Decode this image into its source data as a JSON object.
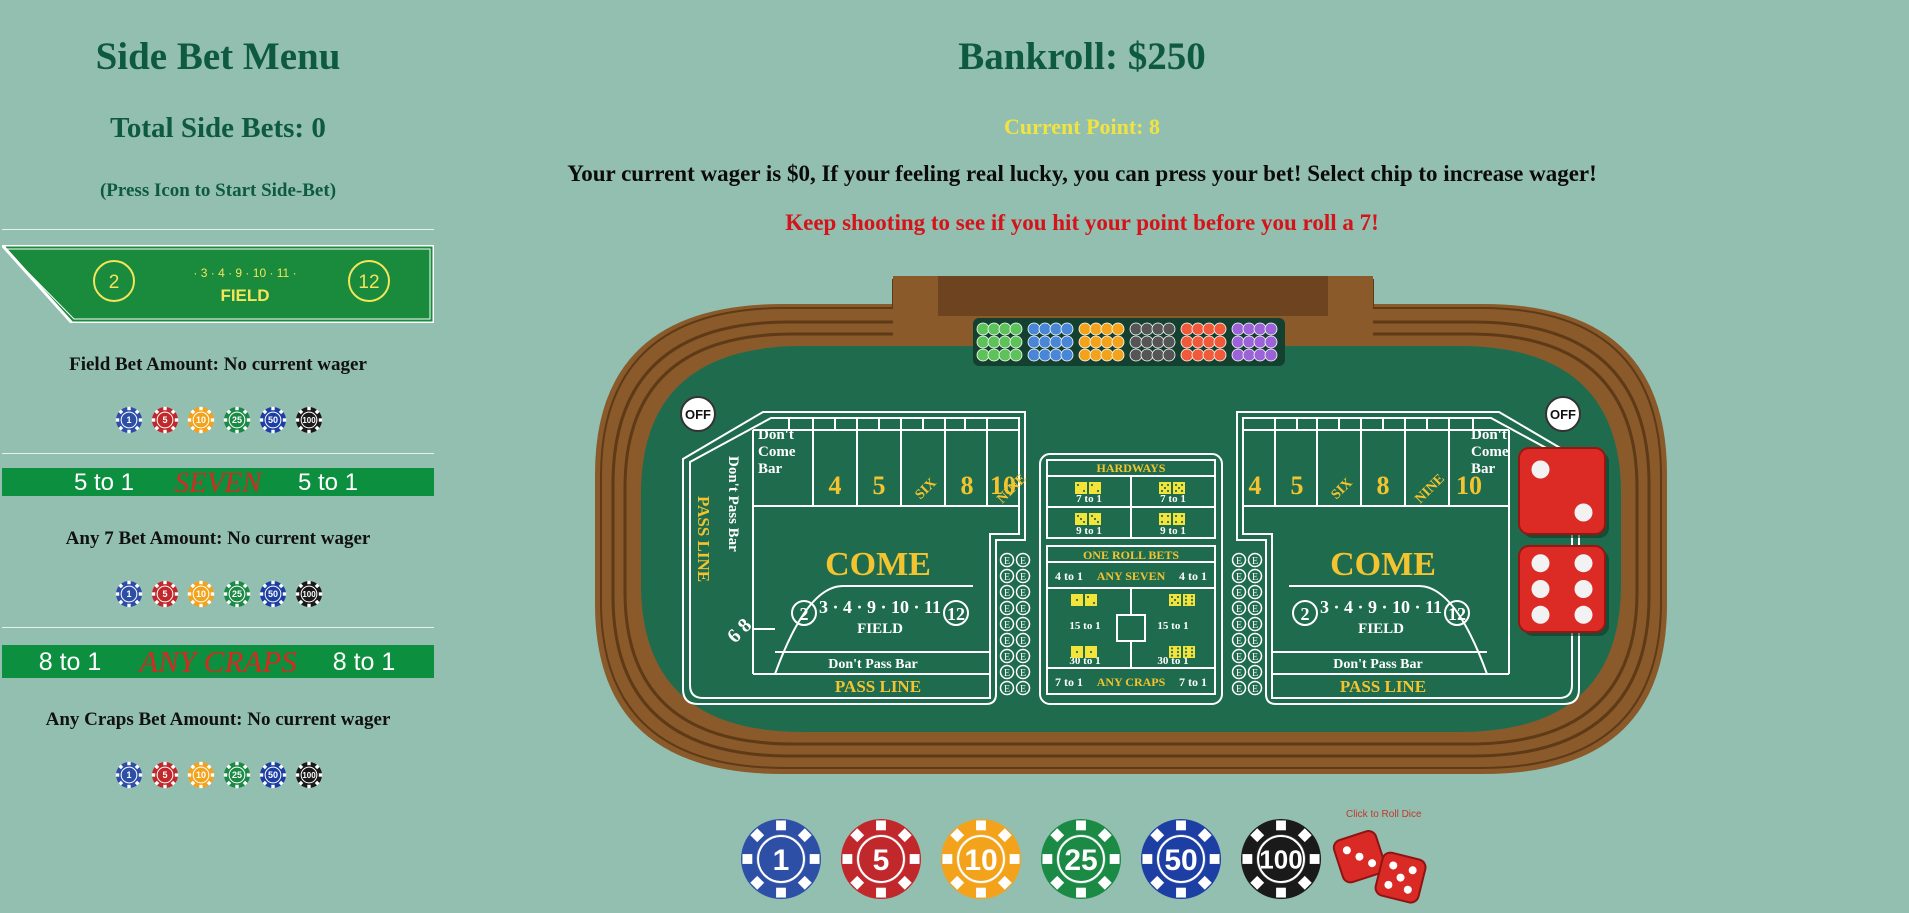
{
  "sidebar": {
    "title": "Side Bet Menu",
    "total": "Total Side Bets: 0",
    "hint": "(Press Icon to Start Side-Bet)",
    "bets": [
      {
        "id": "field",
        "label": "Field Bet Amount: No current wager",
        "banner": {
          "left": "2",
          "right": "12",
          "numbers": "· 3 · 4 · 9 · 10 · 11 ·",
          "word": "FIELD"
        }
      },
      {
        "id": "seven",
        "label": "Any 7 Bet Amount: No current wager",
        "banner": {
          "left": "5 to 1",
          "word": "SEVEN",
          "right": "5 to 1"
        }
      },
      {
        "id": "craps",
        "label": "Any Craps Bet Amount: No current wager",
        "banner": {
          "left": "8 to 1",
          "word": "ANY CRAPS",
          "right": "8 to 1"
        }
      }
    ]
  },
  "main": {
    "bankroll": "Bankroll: $250",
    "point": "Current Point: 8",
    "wager_msg": "Your current wager is $0, If your feeling real lucky, you can press your bet! Select chip to increase wager!",
    "status_msg": "Keep shooting to see if you hit your point before you roll a 7!",
    "roll_label": "Click to Roll Dice"
  },
  "chips": [
    {
      "value": "1",
      "color": "#2e4fa6",
      "edge": "#ffffff"
    },
    {
      "value": "5",
      "color": "#c0282c",
      "edge": "#ffffff"
    },
    {
      "value": "10",
      "color": "#f2a31b",
      "edge": "#ffffff"
    },
    {
      "value": "25",
      "color": "#1a8a45",
      "edge": "#ffffff"
    },
    {
      "value": "50",
      "color": "#1d3fa3",
      "edge": "#ffffff"
    },
    {
      "value": "100",
      "color": "#1a1a1a",
      "edge": "#ffffff"
    }
  ],
  "table": {
    "off_left": "OFF",
    "off_right": "OFF",
    "dont_come_bar": [
      "Don't",
      "Come",
      "Bar"
    ],
    "dont_pass_bar": "Don't Pass Bar",
    "pass_line": "PASS LINE",
    "come": "COME",
    "field": "FIELD",
    "field_numbers": "3 · 4 · 9 · 10 · 11",
    "field_left": "2",
    "field_right": "12",
    "six_eight": "6 8",
    "numbers": [
      "4",
      "5",
      "SIX",
      "8",
      "NINE",
      "10"
    ],
    "hardways": "HARDWAYS",
    "hardway_odds": [
      "7 to 1",
      "7 to 1",
      "9 to 1",
      "9 to 1"
    ],
    "one_roll": "ONE ROLL BETS",
    "any_seven": "ANY SEVEN",
    "any_seven_odds": "4 to 1",
    "prop_odds": [
      "15 to 1",
      "15 to 1",
      "30 to 1",
      "30 to 1"
    ],
    "any_craps": "ANY CRAPS",
    "any_craps_odds": "7 to 1",
    "ce": "E",
    "die1": 2,
    "die2": 6,
    "colors": {
      "felt": "#1f6b4e",
      "gold": "#f4c430",
      "line": "#ffffff"
    }
  }
}
